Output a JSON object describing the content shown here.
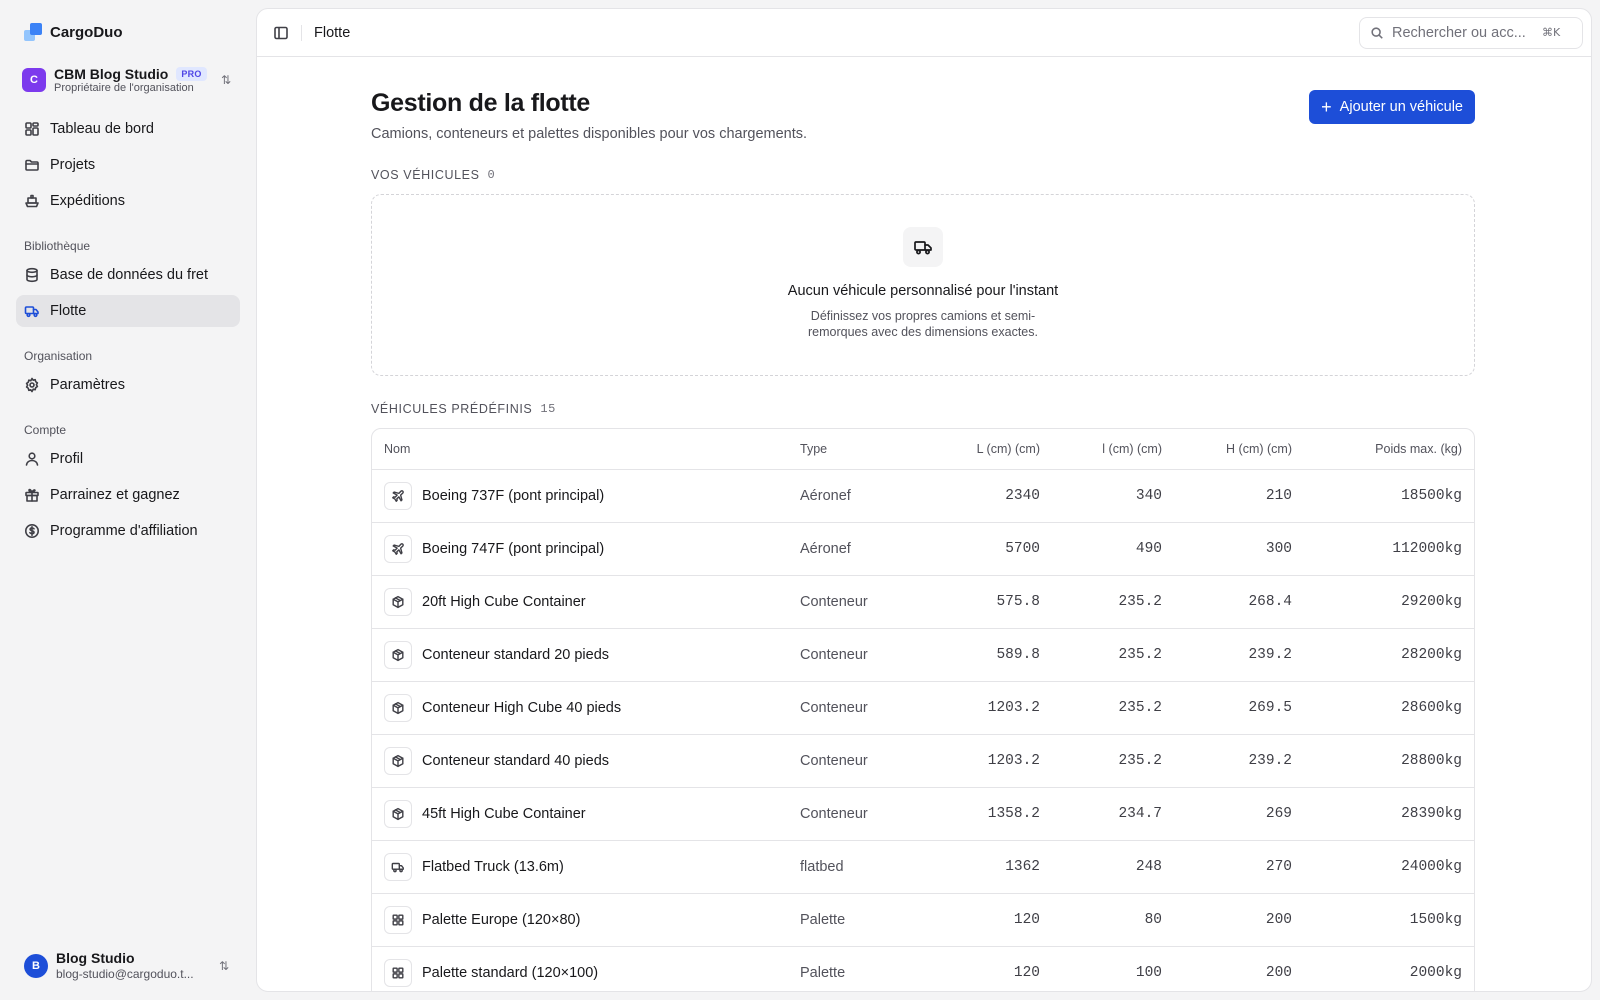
{
  "brand": {
    "name": "CargoDuo"
  },
  "org": {
    "initial": "C",
    "name": "CBM Blog Studio",
    "badge": "PRO",
    "role": "Propriétaire de l'organisation"
  },
  "nav_main": [
    {
      "label": "Tableau de bord",
      "icon": "dashboard-icon"
    },
    {
      "label": "Projets",
      "icon": "folder-icon"
    },
    {
      "label": "Expéditions",
      "icon": "ship-icon"
    }
  ],
  "library": {
    "label": "Bibliothèque",
    "items": [
      {
        "label": "Base de données du fret",
        "icon": "database-icon",
        "active": false
      },
      {
        "label": "Flotte",
        "icon": "truck-icon",
        "active": true
      }
    ]
  },
  "organisation": {
    "label": "Organisation",
    "items": [
      {
        "label": "Paramètres",
        "icon": "gear-icon"
      }
    ]
  },
  "account": {
    "label": "Compte",
    "items": [
      {
        "label": "Profil",
        "icon": "user-icon"
      },
      {
        "label": "Parrainez et gagnez",
        "icon": "gift-icon"
      },
      {
        "label": "Programme d'affiliation",
        "icon": "dollar-circle-icon"
      }
    ]
  },
  "user": {
    "initial": "B",
    "name": "Blog Studio",
    "email": "blog-studio@cargoduo.t..."
  },
  "topbar": {
    "breadcrumb": "Flotte",
    "search_placeholder": "Rechercher ou acc...",
    "shortcut": "⌘K"
  },
  "page": {
    "title": "Gestion de la flotte",
    "subtitle": "Camions, conteneurs et palettes disponibles pour vos chargements.",
    "add_button": "Ajouter un véhicule"
  },
  "your_vehicles": {
    "label": "VOS VÉHICULES",
    "count": "0",
    "empty_title": "Aucun véhicule personnalisé pour l'instant",
    "empty_desc": "Définissez vos propres camions et semi-remorques avec des dimensions exactes."
  },
  "predefined": {
    "label": "VÉHICULES PRÉDÉFINIS",
    "count": "15",
    "columns": [
      "Nom",
      "Type",
      "L (cm) (cm)",
      "l (cm) (cm)",
      "H (cm) (cm)",
      "Poids max. (kg)"
    ],
    "rows": [
      {
        "icon": "plane-icon",
        "name": "Boeing 737F (pont principal)",
        "type": "Aéronef",
        "l": "2340",
        "w": "340",
        "h": "210",
        "p": "18500kg"
      },
      {
        "icon": "plane-icon",
        "name": "Boeing 747F (pont principal)",
        "type": "Aéronef",
        "l": "5700",
        "w": "490",
        "h": "300",
        "p": "112000kg"
      },
      {
        "icon": "container-icon",
        "name": "20ft High Cube Container",
        "type": "Conteneur",
        "l": "575.8",
        "w": "235.2",
        "h": "268.4",
        "p": "29200kg"
      },
      {
        "icon": "container-icon",
        "name": "Conteneur standard 20 pieds",
        "type": "Conteneur",
        "l": "589.8",
        "w": "235.2",
        "h": "239.2",
        "p": "28200kg"
      },
      {
        "icon": "container-icon",
        "name": "Conteneur High Cube 40 pieds",
        "type": "Conteneur",
        "l": "1203.2",
        "w": "235.2",
        "h": "269.5",
        "p": "28600kg"
      },
      {
        "icon": "container-icon",
        "name": "Conteneur standard 40 pieds",
        "type": "Conteneur",
        "l": "1203.2",
        "w": "235.2",
        "h": "239.2",
        "p": "28800kg"
      },
      {
        "icon": "container-icon",
        "name": "45ft High Cube Container",
        "type": "Conteneur",
        "l": "1358.2",
        "w": "234.7",
        "h": "269",
        "p": "28390kg"
      },
      {
        "icon": "truck-icon",
        "name": "Flatbed Truck (13.6m)",
        "type": "flatbed",
        "l": "1362",
        "w": "248",
        "h": "270",
        "p": "24000kg"
      },
      {
        "icon": "pallet-icon",
        "name": "Palette Europe (120×80)",
        "type": "Palette",
        "l": "120",
        "w": "80",
        "h": "200",
        "p": "1500kg"
      },
      {
        "icon": "pallet-icon",
        "name": "Palette standard (120×100)",
        "type": "Palette",
        "l": "120",
        "w": "100",
        "h": "200",
        "p": "2000kg"
      }
    ]
  },
  "colors": {
    "accent": "#1d4ed8",
    "org_avatar": "#7c3aed",
    "user_avatar": "#1d4ed8"
  }
}
